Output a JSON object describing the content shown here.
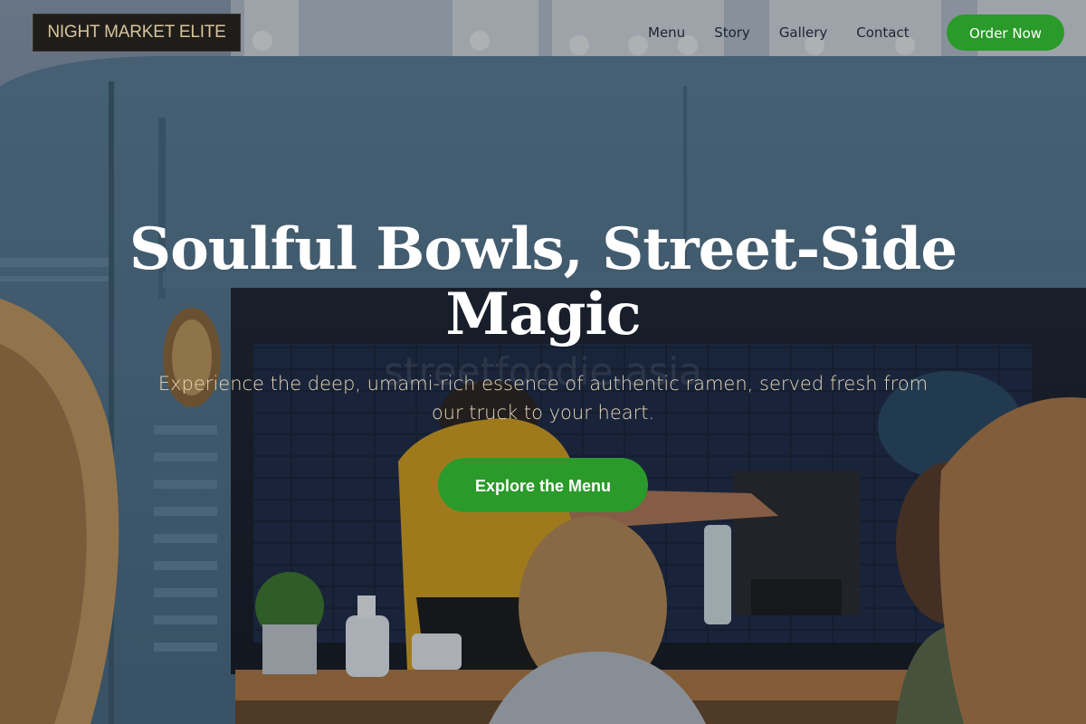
{
  "brand": {
    "logo_text": "NIGHT MARKET ELITE"
  },
  "nav": {
    "items": [
      {
        "label": "Menu"
      },
      {
        "label": "Story"
      },
      {
        "label": "Gallery"
      },
      {
        "label": "Contact"
      }
    ],
    "order_label": "Order Now"
  },
  "hero": {
    "headline": "Soulful Bowls, Street-Side Magic",
    "subtext": "Experience the deep, umami-rich essence of authentic ramen, served fresh from our truck to your heart.",
    "cta_label": "Explore the Menu",
    "background_scene": "food-truck-photo",
    "background_watermark": "streetfoodie.asia"
  },
  "colors": {
    "accent_green": "#2a9a2a",
    "logo_bg": "#1f1d1a",
    "logo_text": "#d8c49a",
    "subtext": "#e8d7b7",
    "nav_text": "#1d2430"
  }
}
